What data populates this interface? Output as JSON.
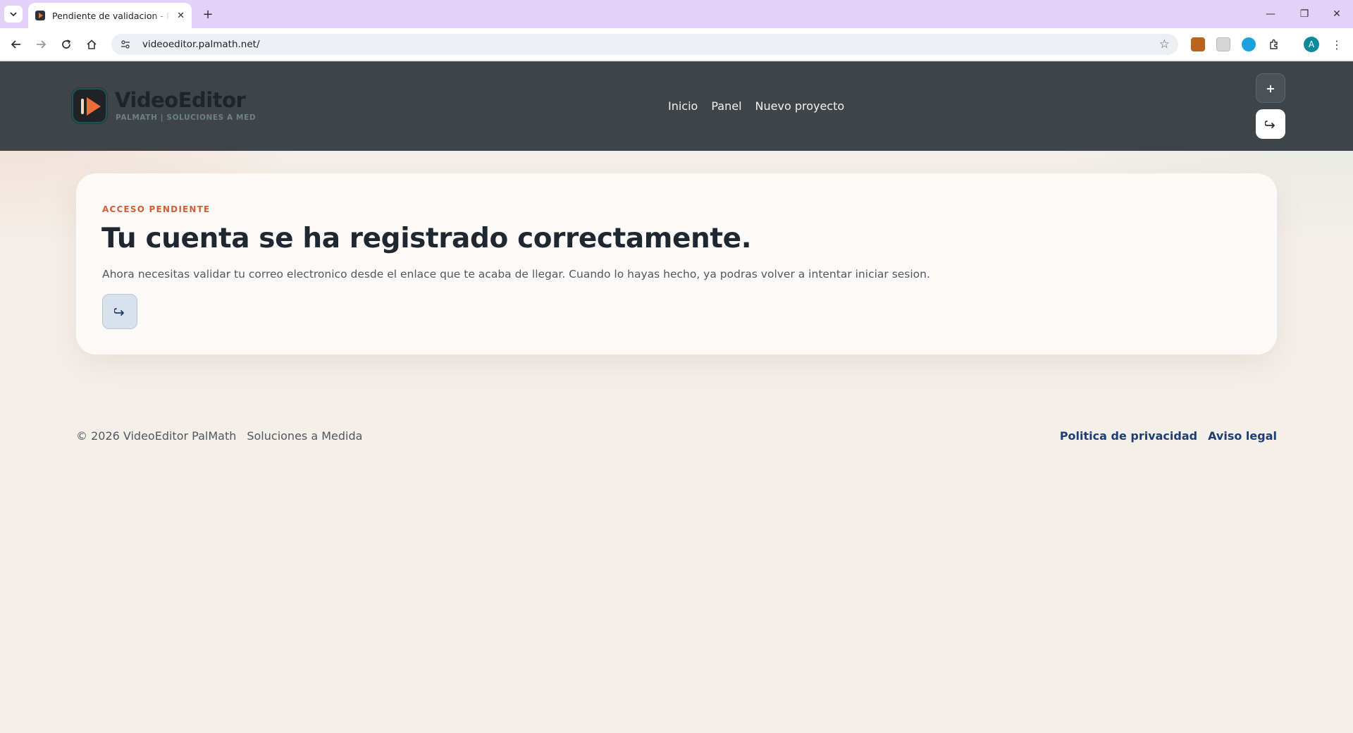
{
  "browser": {
    "tab_title": "Pendiente de validacion - PalMath",
    "tab_close": "✕",
    "new_tab": "+",
    "url": "videoeditor.palmath.net/",
    "profile_initial": "A",
    "window_controls": [
      "—",
      "❐",
      "✕"
    ]
  },
  "header": {
    "brand_name": "VideoEditor",
    "brand_subtitle": "PALMATH | SOLUCIONES A MED",
    "nav": [
      "Inicio",
      "Panel",
      "Nuevo proyecto"
    ],
    "plus_label": "+",
    "login_icon": "login-arrow-icon"
  },
  "card": {
    "eyebrow": "ACCESO PENDIENTE",
    "title": "Tu cuenta se ha registrado correctamente.",
    "description": "Ahora necesitas validar tu correo electronico desde el enlace que te acaba de llegar. Cuando lo hayas hecho, ya podras volver a intentar iniciar sesion.",
    "button_icon": "login-arrow-icon"
  },
  "footer": {
    "copyright": "© 2026 VideoEditor PalMath",
    "tagline": "Soluciones a Medida",
    "links": [
      "Politica de privacidad",
      "Aviso legal"
    ]
  },
  "colors": {
    "header_bg": "#3f4449",
    "accent_orange": "#f26c3a",
    "eyebrow": "#d05e34",
    "link_blue": "#1d3e72",
    "tabbar_bg": "#e4d1f7"
  }
}
